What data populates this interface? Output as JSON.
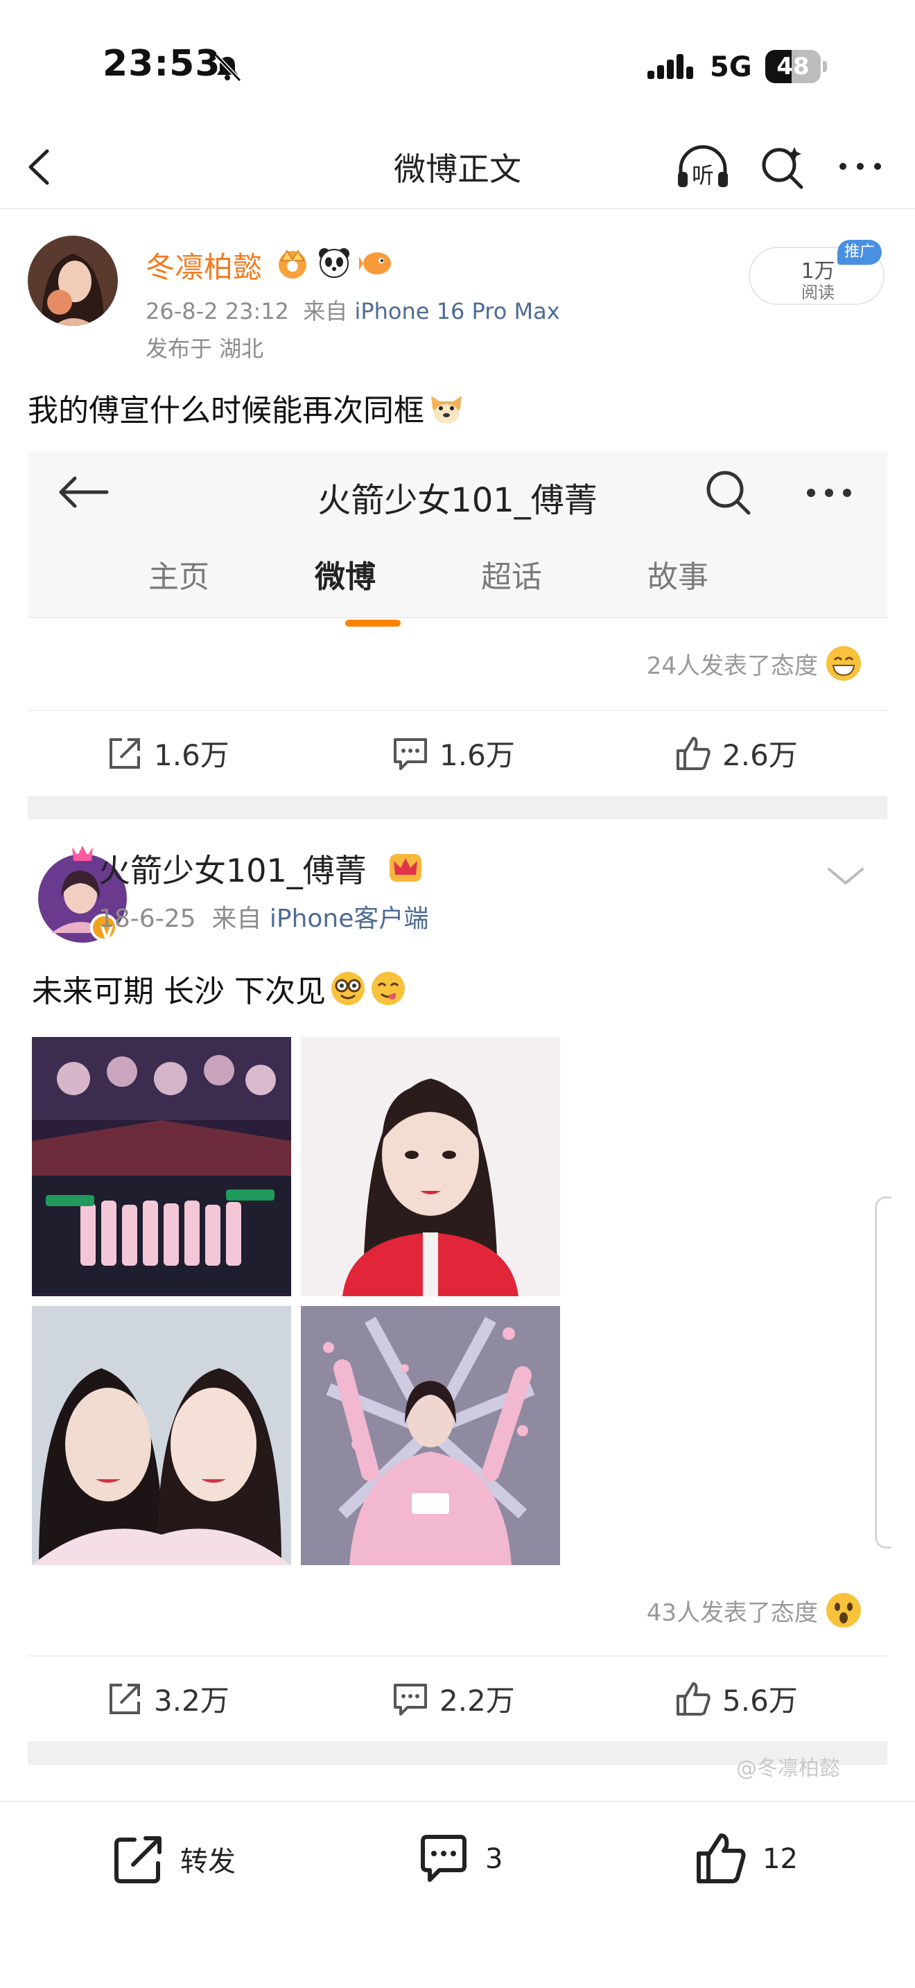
{
  "status_bar": {
    "time": "23:53",
    "network": "5G",
    "battery": "48",
    "battery_level": 0.48
  },
  "nav": {
    "title": "微博正文",
    "listen_label": "听"
  },
  "author": {
    "name": "冬凛柏懿",
    "time": "26-8-2 23:12",
    "source_prefix": "来自",
    "device": "iPhone 16 Pro Max",
    "location": "发布于 湖北",
    "read_count": "1万",
    "read_label": "阅读",
    "promo_tag": "推广"
  },
  "post_text": "我的傅宣什么时候能再次同框",
  "embed": {
    "title": "火箭少女101_傅菁",
    "tabs": [
      "主页",
      "微博",
      "超话",
      "故事"
    ],
    "active_tab_index": 1,
    "prev_post": {
      "reactions": "24人发表了态度",
      "reposts": "1.6万",
      "comments": "1.6万",
      "likes": "2.6万"
    },
    "post": {
      "author": "火箭少女101_傅菁",
      "time": "18-6-25",
      "source_prefix": "来自",
      "device": "iPhone客户端",
      "verified_label": "V",
      "text": "未来可期 长沙 下次见",
      "reactions": "43人发表了态度",
      "reposts": "3.2万",
      "comments": "2.2万",
      "likes": "5.6万"
    }
  },
  "watermark": "@冬凛柏懿",
  "toolbar": {
    "repost_label": "转发",
    "comment_count": "3",
    "like_count": "12"
  },
  "colors": {
    "author_name": "#f47a1f",
    "link": "#4e6b95",
    "tab_indicator": "#ff8200",
    "promo": "#4a90e2"
  }
}
